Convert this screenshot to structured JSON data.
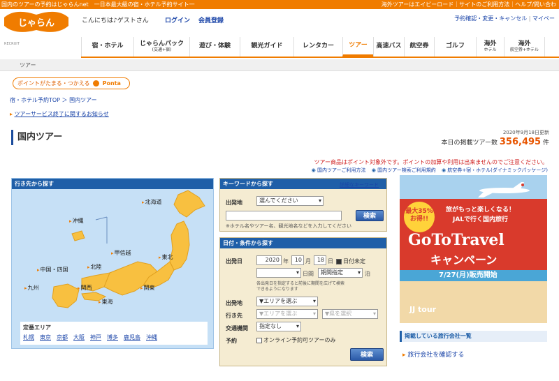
{
  "topbar": {
    "left_text": "国内のツアーの予約はじゃらんnet　一日本最大級の宿・ホテル予約サイト一",
    "right_text": "海外ツアーはエイビーロード｜サイトのご利用方法｜ヘルプ/問い合わ"
  },
  "header": {
    "logo_text": "じゃらん",
    "logo_sub": "RECRUIT",
    "greeting": "こんにちは♪ゲストさん",
    "login": "ログイン",
    "register": "会員登録",
    "utils": [
      "予約確認・変更・キャンセル",
      "マイペー"
    ]
  },
  "nav": {
    "items": [
      {
        "label": "宿・ホテル",
        "sub": ""
      },
      {
        "label": "じゃらんパック",
        "sub": "(交通+宿)"
      },
      {
        "label": "遊び・体験",
        "sub": ""
      },
      {
        "label": "観光ガイド",
        "sub": ""
      },
      {
        "label": "レンタカー",
        "sub": ""
      },
      {
        "label": "ツアー",
        "sub": ""
      },
      {
        "label": "高速バス",
        "sub": ""
      },
      {
        "label": "航空券",
        "sub": ""
      },
      {
        "label": "ゴルフ",
        "sub": ""
      },
      {
        "label": "海外",
        "sub": "ホテル"
      },
      {
        "label": "海外",
        "sub": "航空券+ホテル"
      }
    ],
    "active_index": 5
  },
  "subnav": {
    "label": "ツアー"
  },
  "ponta": {
    "text": "ポイントがたまる・つかえる",
    "brand": "Ponta"
  },
  "breadcrumb": "宿・ホテル予約TOP ＞ 国内ツアー",
  "notice": "ツアーサービス終了に関するお知らせ",
  "page_title": "国内ツアー",
  "count": {
    "updated": "2020年9月18日更新",
    "label": "本日の掲載ツアー数",
    "value": "356,495",
    "unit": "件"
  },
  "disclaimer": "ツアー商品はポイント対象外です。ポイントの加算や利用は出来ませんのでご注意ください。",
  "guide_links": [
    "国内ツアーご利用方法",
    "国内ツアー検索ご利用規約",
    "航空券+宿・ホテル(ダイナミックパッケージ)"
  ],
  "map_panel": {
    "header": "行き先から探す",
    "prefs": [
      "北海道",
      "沖縄",
      "東北",
      "甲信越",
      "北陸",
      "中国・四国",
      "九州",
      "関西",
      "関東",
      "東海"
    ],
    "areas_title": "定番エリア",
    "areas": [
      "札幌",
      "東京",
      "京都",
      "大阪",
      "神戸",
      "博多",
      "鹿児島",
      "沖縄"
    ]
  },
  "keyword_panel": {
    "header": "キーワードから探す",
    "detail_link": "詳細なキーワード",
    "origin_label": "出発地",
    "origin_value": "選んでください",
    "keyword_placeholder": "",
    "search_button": "検索",
    "hint": "※ホテル名やツアー名、観光地名などを入力してください"
  },
  "date_panel": {
    "header": "日付・条件から探す",
    "departure_label": "出発日",
    "year": "2020",
    "year_unit": "年",
    "month": "10",
    "month_unit": "月",
    "day": "18",
    "day_unit": "日",
    "undecided": "日付未定",
    "nights_value": "",
    "nights_unit": "日間",
    "period_value": "期間指定",
    "stay_unit": "泊",
    "hint_line1": "各出発日を指定すると前後に期間を広げて検索",
    "hint_line2": "できるようになります",
    "origin_label": "出発地",
    "origin_value": "▼エリアを選ぶ",
    "dest_label": "行き先",
    "dest_area": "▼エリアを選ぶ",
    "dest_pref": "▼県を選択",
    "transport_label": "交通機関",
    "transport_value": "指定なし",
    "booking_label": "予約",
    "online_only": "オンライン予約可ツアーのみ",
    "search_button": "検索"
  },
  "banner": {
    "promo_pct": "最大35%",
    "promo_deal": "お得!!",
    "tagline1": "旅がもっと楽しくなる！",
    "tagline2": "JALで行く国内旅行",
    "title_en": "GoToTravel",
    "title_jp": "キャンペーン",
    "date": "7/27(月)販売開始",
    "brand": "JJ tour"
  },
  "companies": {
    "header": "掲載している旅行会社一覧",
    "link": "旅行会社を確認する"
  },
  "colors": {
    "brand": "#f07c00",
    "nav_blue": "#1f5fa8",
    "price": "#e85500"
  }
}
